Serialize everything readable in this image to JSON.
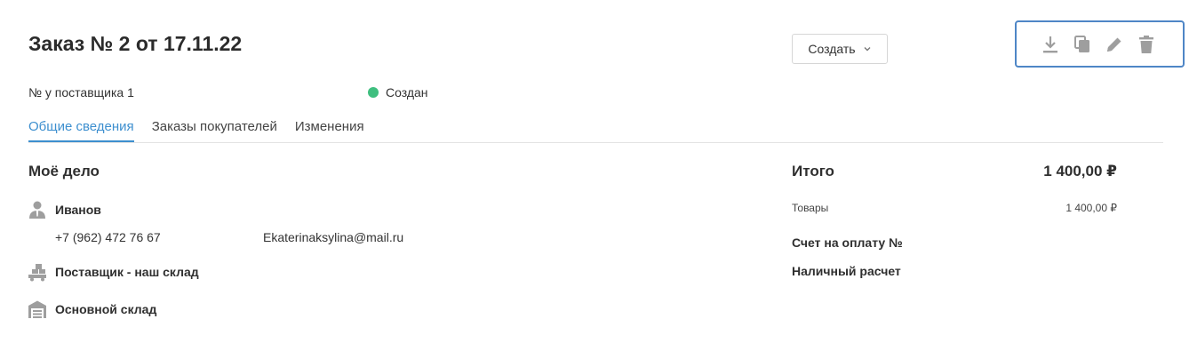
{
  "header": {
    "title": "Заказ № 2 от 17.11.22",
    "create_label": "Создать",
    "toolbar_icons": [
      "download-icon",
      "copy-icon",
      "edit-icon",
      "delete-icon"
    ]
  },
  "meta": {
    "supplier_number": "№ у поставщика 1",
    "status": "Создан",
    "status_color": "#3fbf7f"
  },
  "tabs": [
    {
      "label": "Общие сведения",
      "active": true
    },
    {
      "label": "Заказы покупателей",
      "active": false
    },
    {
      "label": "Изменения",
      "active": false
    }
  ],
  "left": {
    "section_title": "Моё дело",
    "contact": {
      "name": "Иванов",
      "phone": "+7 (962) 472 76 67",
      "email": "Ekaterinaksylina@mail.ru"
    },
    "supplier": "Поставщик - наш склад",
    "warehouse": "Основной склад"
  },
  "right": {
    "total_label": "Итого",
    "total_value": "1 400,00 ₽",
    "goods_label": "Товары",
    "goods_value": "1 400,00 ₽",
    "invoice_label": "Счет на оплату №",
    "payment_method": "Наличный расчет"
  },
  "colors": {
    "accent": "#3d8fcf",
    "toolbar_border": "#4f86c6",
    "icon_gray": "#9e9e9e"
  }
}
